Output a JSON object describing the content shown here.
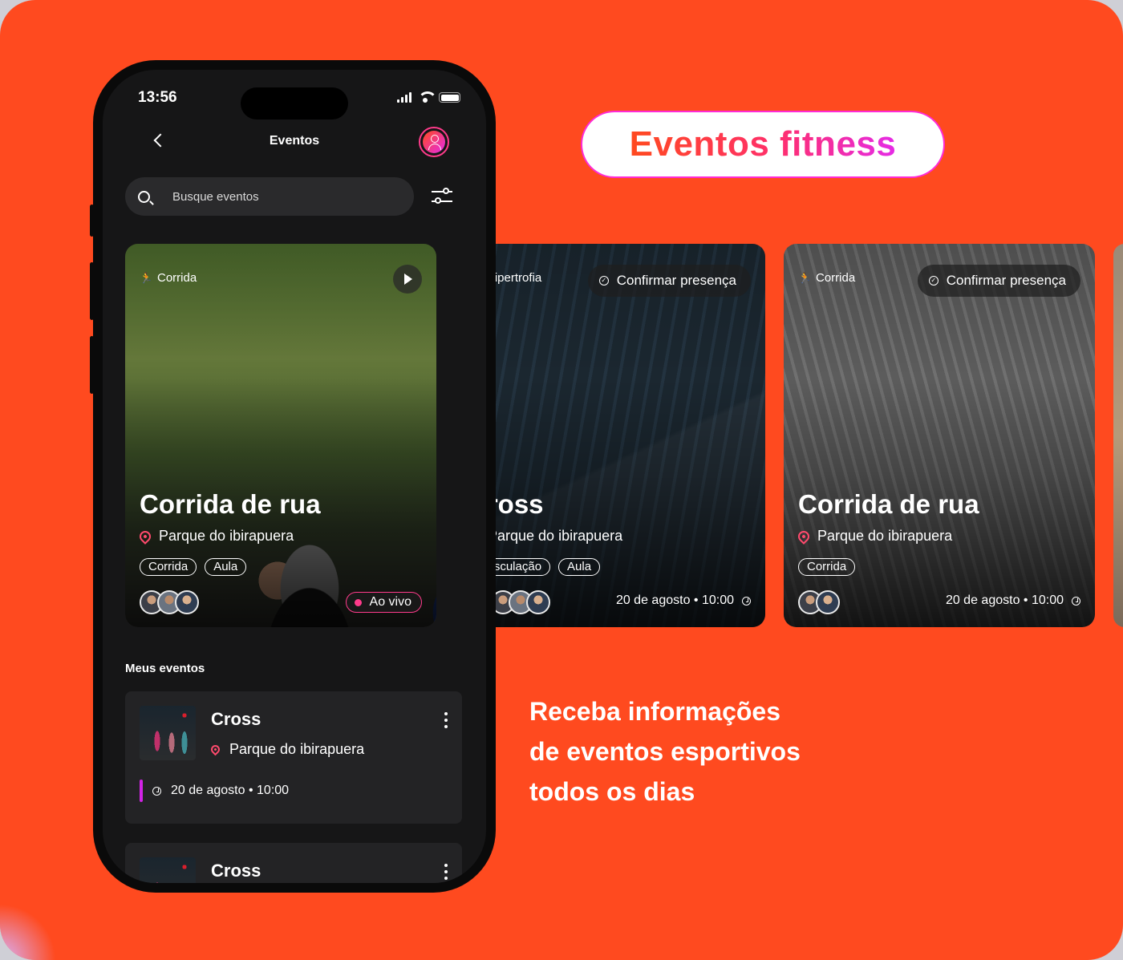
{
  "promo": {
    "title": "Eventos fitness",
    "tagline": [
      "Receba informações",
      "de eventos esportivos",
      "todos os dias"
    ]
  },
  "status_bar": {
    "time": "13:56"
  },
  "header": {
    "title": "Eventos"
  },
  "search": {
    "placeholder": "Busque eventos"
  },
  "featured": [
    {
      "category": "Corrida",
      "title": "Corrida de rua",
      "location": "Parque do ibirapuera",
      "tags": [
        "Corrida",
        "Aula"
      ],
      "live_label": "Ao vivo"
    },
    {
      "category": "Hipertrofia",
      "confirm_label": "Confirmar presença",
      "title": "Cross",
      "location": "Parque do ibirapuera",
      "tags": [
        "Musculação",
        "Aula"
      ],
      "datetime": "20 de agosto • 10:00"
    },
    {
      "category": "Corrida",
      "confirm_label": "Confirmar presença",
      "title": "Corrida de rua",
      "location": "Parque do ibirapuera",
      "tags": [
        "Corrida"
      ],
      "datetime": "20 de agosto • 10:00"
    }
  ],
  "my_events": {
    "title": "Meus eventos",
    "items": [
      {
        "title": "Cross",
        "location": "Parque do ibirapuera",
        "datetime": "20 de agosto • 10:00"
      },
      {
        "title": "Cross"
      }
    ]
  },
  "colors": {
    "background": "#ff4a1f",
    "accent": "#e52be6",
    "live": "#ff3b8b",
    "phone_bg": "#161617"
  }
}
